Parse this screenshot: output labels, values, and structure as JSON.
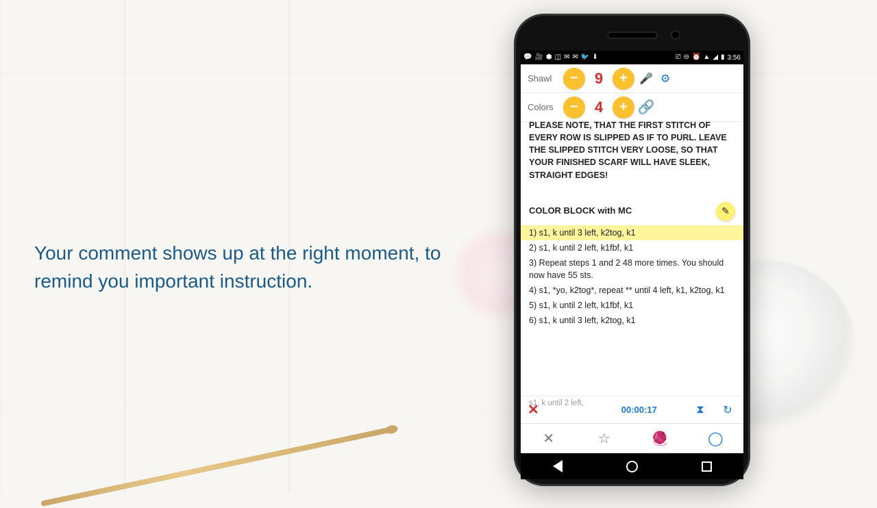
{
  "caption": "Your comment shows up at the right moment, to remind you important instruction.",
  "statusbar": {
    "time": "3:56"
  },
  "counters": [
    {
      "label": "Shawl",
      "value": "9",
      "icon1": "mic",
      "icon2": "gears"
    },
    {
      "label": "Colors",
      "value": "4",
      "icon1": "link",
      "icon2": ""
    }
  ],
  "note_text": "PLEASE NOTE, THAT THE FIRST STITCH OF EVERY ROW IS SLIPPED AS IF TO PURL. LEAVE THE SLIPPED STITCH VERY LOOSE, SO THAT YOUR FINISHED SCARF WILL HAVE SLEEK, STRAIGHT EDGES!",
  "section_title": "COLOR BLOCK with MC",
  "steps": [
    "1) s1, k until 3 left, k2tog, k1",
    "2) s1, k until 2 left, k1fbf, k1",
    "3) Repeat steps 1 and 2 48 more times. You should now have 55 sts.",
    "4) s1, *yo, k2tog*, repeat ** until 4 left, k1, k2tog, k1",
    "5) s1, k until 2 left, k1fbf, k1",
    "6) s1, k until 3 left, k2tog, k1"
  ],
  "highlight_index": 0,
  "timer": {
    "behind_text": "s1, k until 2 left,",
    "elapsed": "00:00:17"
  }
}
